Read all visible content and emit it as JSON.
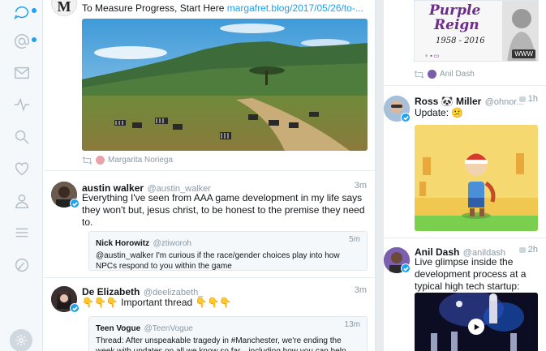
{
  "sidebar": {
    "icons": [
      "home-icon",
      "mentions-icon",
      "messages-icon",
      "activity-icon",
      "search-icon",
      "likes-icon",
      "profile-icon",
      "lists-icon",
      "new-tweet-icon",
      "settings-icon"
    ]
  },
  "col1": {
    "tweet1": {
      "text_prefix": "To Measure Progress, Start Here ",
      "link": "margafret.blog/2017/05/26/to-...",
      "retweeter": "Margarita Noriega"
    },
    "tweet2": {
      "name": "austin walker",
      "handle": "@austin_walker",
      "time": "3m",
      "text": "Everything I've seen from AAA game development in my life says they won't but, jesus christ, to be honest to the premise they need to.",
      "quote": {
        "name": "Nick Horowitz",
        "handle": "@ztiworoh",
        "time": "5m",
        "text": "@austin_walker I'm curious if the race/gender choices play into how NPCs respond to you within the game"
      }
    },
    "tweet3": {
      "name": "De Elizabeth",
      "handle": "@deelizabeth_",
      "time": "3m",
      "text": "👇👇👇 Important thread 👇👇👇",
      "quote": {
        "name": "Teen Vogue",
        "handle": "@TeenVogue",
        "time": "13m",
        "text": "Thread: After unspeakable tragedy in #Manchester, we're ending the week with updates on all we know so far—including how you can help."
      }
    }
  },
  "col2": {
    "card": {
      "art_text_1": "Purple",
      "art_text_2": "Reign",
      "art_years": "1958 - 2016",
      "badge": "WWW"
    },
    "retweeter": "Anil Dash",
    "tweet1": {
      "name": "Ross 🐼 Miller",
      "handle": "@ohnor...",
      "time": "1h",
      "text": "Update: 😕"
    },
    "tweet2": {
      "name": "Anil Dash",
      "handle": "@anildash",
      "time": "2h",
      "text": "Live glimpse inside the development process at a typical high tech startup:"
    }
  }
}
